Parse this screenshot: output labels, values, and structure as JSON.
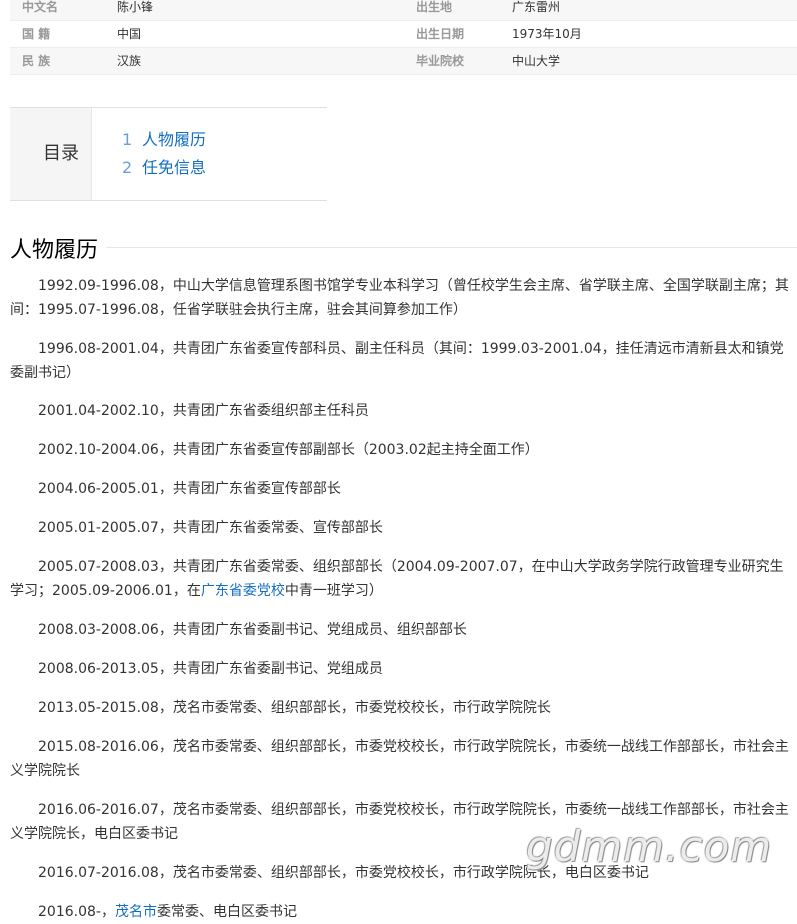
{
  "basic_info": {
    "rows": [
      {
        "label1": "中文名",
        "value1": "陈小锋",
        "label2": "出生地",
        "value2": "广东雷州"
      },
      {
        "label1": "国 籍",
        "value1": "中国",
        "label2": "出生日期",
        "value2": "1973年10月"
      },
      {
        "label1": "民 族",
        "value1": "汉族",
        "label2": "毕业院校",
        "value2": "中山大学"
      }
    ]
  },
  "toc": {
    "title": "目录",
    "items": [
      {
        "num": "1",
        "label": "人物履历"
      },
      {
        "num": "2",
        "label": "任免信息"
      }
    ]
  },
  "section": {
    "title": "人物履历"
  },
  "paragraphs": [
    {
      "text": "1992.09-1996.08，中山大学信息管理系图书馆学专业本科学习（曾任校学生会主席、省学联主席、全国学联副主席；其间：1995.07-1996.08，任省学联驻会执行主席，驻会其间算参加工作）"
    },
    {
      "text": "1996.08-2001.04，共青团广东省委宣传部科员、副主任科员（其间：1999.03-2001.04，挂任清远市清新县太和镇党委副书记）"
    },
    {
      "text": "2001.04-2002.10，共青团广东省委组织部主任科员"
    },
    {
      "text": "2002.10-2004.06，共青团广东省委宣传部副部长（2003.02起主持全面工作）"
    },
    {
      "text": "2004.06-2005.01，共青团广东省委宣传部部长"
    },
    {
      "text": "2005.01-2005.07，共青团广东省委常委、宣传部部长"
    },
    {
      "pre": "2005.07-2008.03，共青团广东省委常委、组织部部长（2004.09-2007.07，在中山大学政务学院行政管理专业研究生学习；2005.09-2006.01，在",
      "link": "广东省委党校",
      "post": "中青一班学习）"
    },
    {
      "text": "2008.03-2008.06，共青团广东省委副书记、党组成员、组织部部长"
    },
    {
      "text": "2008.06-2013.05，共青团广东省委副书记、党组成员"
    },
    {
      "text": "2013.05-2015.08，茂名市委常委、组织部部长，市委党校校长，市行政学院院长"
    },
    {
      "text": "2015.08-2016.06，茂名市委常委、组织部部长，市委党校校长，市行政学院院长，市委统一战线工作部部长，市社会主义学院院长"
    },
    {
      "text": "2016.06-2016.07，茂名市委常委、组织部部长，市委党校校长，市行政学院院长，市委统一战线工作部部长，市社会主义学院院长，电白区委书记"
    },
    {
      "text": "2016.07-2016.08，茂名市委常委、组织部部长，市委党校校长，市行政学院院长，电白区委书记"
    },
    {
      "pre": "2016.08-，",
      "link": "茂名市",
      "post": "委常委、电白区委书记"
    }
  ],
  "watermark": "gdmm.com"
}
